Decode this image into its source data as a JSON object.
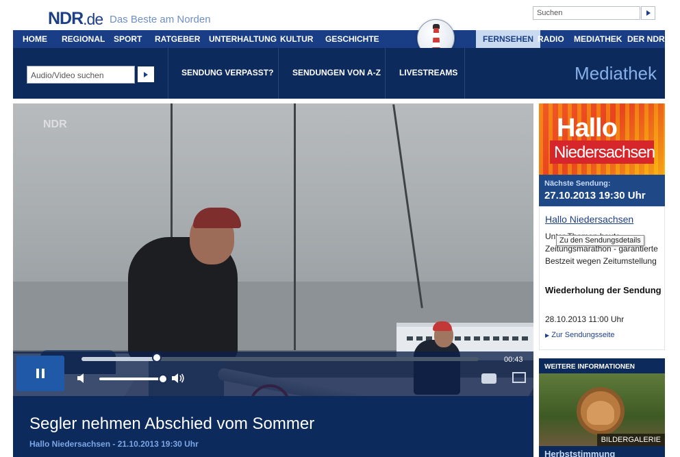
{
  "header": {
    "logo_main": "NDR",
    "logo_suffix": ".de",
    "tagline": "Das Beste am Norden",
    "search_placeholder": "Suchen"
  },
  "nav": {
    "items": [
      "HOME",
      "REGIONAL",
      "SPORT",
      "RATGEBER",
      "UNTERHALTUNG",
      "KULTUR",
      "GESCHICHTE"
    ],
    "right_items": [
      "FERNSEHEN",
      "RADIO",
      "MEDIATHEK",
      "DER NDR"
    ]
  },
  "subnav": {
    "search_placeholder": "Audio/Video suchen",
    "links": [
      "SENDUNG VERPASST?",
      "SENDUNGEN VON A-Z",
      "LIVESTREAMS"
    ],
    "section_title": "Mediathek"
  },
  "player": {
    "watermark": "NDR",
    "time": "00:43",
    "progress": 0.19,
    "volume": 0.95
  },
  "video": {
    "title": "Segler nehmen Abschied vom Sommer",
    "subtitle": "Hallo Niedersachsen - 21.10.2013 19:30 Uhr"
  },
  "sidebar": {
    "banner_line1": "Hallo",
    "banner_line2": "Niedersachsen",
    "next_label": "Nächste Sendung:",
    "next_date": "27.10.2013 19:30 Uhr",
    "show_link": "Hallo Niedersachsen",
    "description": "Unter Themen heute Zeitungsmarathon - garantierte Bestzeit wegen Zeitumstellung",
    "tooltip": "Zu den Sendungsdetails",
    "repeat_heading": "Wiederholung der Sendung",
    "repeat_date": "28.10.2013 11:00 Uhr",
    "more_link": "Zur Sendungsseite",
    "info_label": "WEITERE INFORMATIONEN",
    "gallery_label": "BILDERGALERIE",
    "info_bottom": "Herbststimmung"
  }
}
